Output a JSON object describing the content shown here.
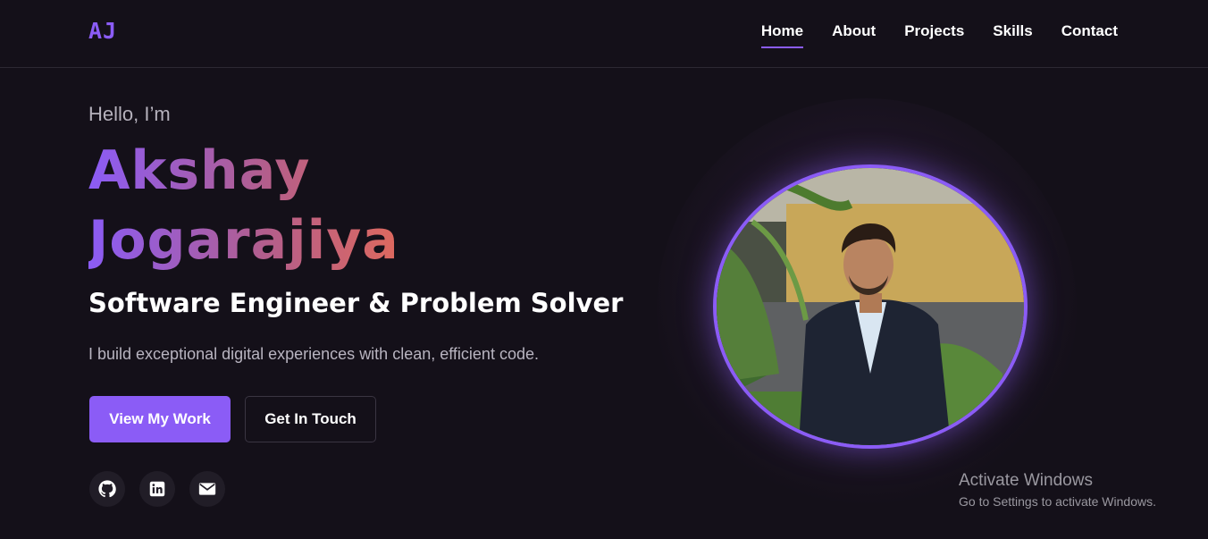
{
  "brand": {
    "logo": "AJ"
  },
  "nav": {
    "items": [
      {
        "label": "Home",
        "active": true
      },
      {
        "label": "About"
      },
      {
        "label": "Projects"
      },
      {
        "label": "Skills"
      },
      {
        "label": "Contact"
      }
    ]
  },
  "hero": {
    "greeting": "Hello, I’m",
    "first_name": "Akshay",
    "last_name": "Jogarajiya",
    "role": "Software Engineer & Problem Solver",
    "description": "I build exceptional digital experiences with clean, efficient code.",
    "primary_button": "View My Work",
    "secondary_button": "Get In Touch"
  },
  "socials": [
    {
      "icon": "github-icon"
    },
    {
      "icon": "linkedin-icon"
    },
    {
      "icon": "mail-icon"
    }
  ],
  "watermark": {
    "title": "Activate Windows",
    "subtitle": "Go to Settings to activate Windows."
  },
  "colors": {
    "accent": "#8b5cf6",
    "background": "#141019",
    "gradient_end": "#e26a5a"
  }
}
